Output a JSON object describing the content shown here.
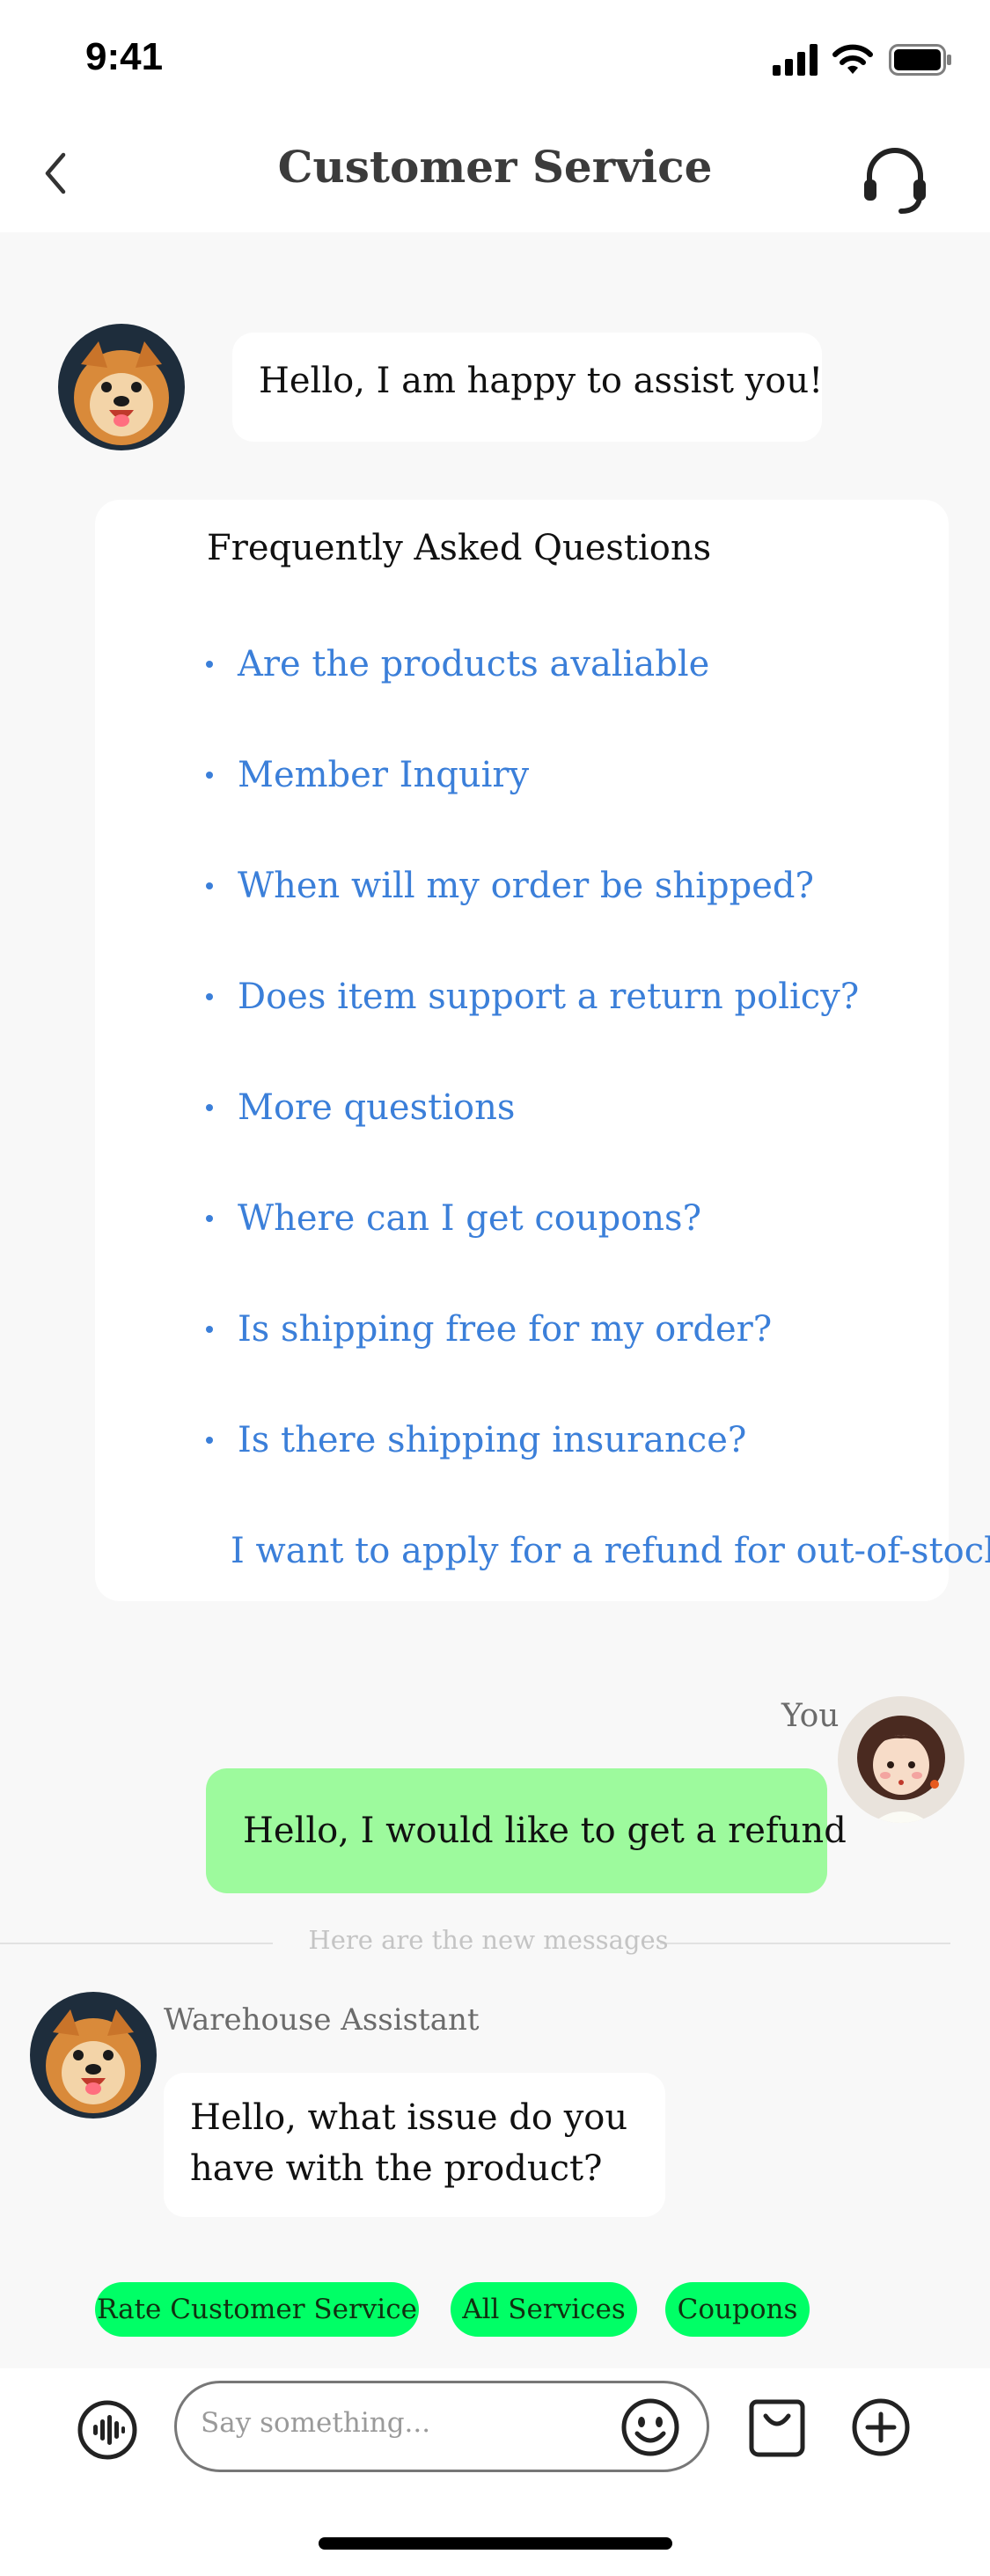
{
  "status_bar": {
    "time": "9:41"
  },
  "header": {
    "title": "Customer Service"
  },
  "messages": {
    "greeting": "Hello, I am happy to assist you!",
    "faq": {
      "title": "Frequently Asked Questions",
      "items": [
        "Are the products avaliable",
        "Member Inquiry",
        "When will my order be shipped?",
        "Does item support a return policy?",
        "More questions",
        "Where can I get coupons?",
        "Is shipping free for my order?",
        "Is there shipping insurance?",
        "I want to apply for a refund for out-of-stock"
      ]
    },
    "user_label": "You",
    "user_message": "Hello, I would like to get a refund",
    "divider_text": "Here are the new messages",
    "assistant_name": "Warehouse Assistant",
    "assistant_message": [
      "Hello, what issue do you",
      "have with the product?"
    ]
  },
  "quick_actions": [
    "Rate Customer Service",
    "All Services",
    "Coupons"
  ],
  "composer": {
    "placeholder": "Say something..."
  },
  "colors": {
    "link": "#3b7fd9",
    "user_bubble": "#9dfa9d",
    "chip": "#00ff66"
  },
  "icons": {
    "back": "chevron-left-icon",
    "support": "headset-icon",
    "voice": "voice-wave-icon",
    "emoji": "smiley-icon",
    "shop": "shopping-bag-icon",
    "add": "plus-circle-icon"
  }
}
